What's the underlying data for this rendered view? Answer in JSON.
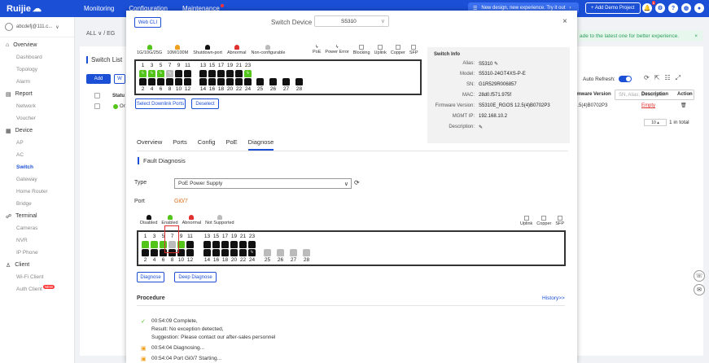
{
  "brand": {
    "logo": "Ruijie",
    "sub": "Cloud"
  },
  "topnav": {
    "items": [
      "Monitoring",
      "Configuration",
      "Maintenance"
    ],
    "new_design": "New design, new experience. Try it out",
    "demo": "+ Add Demo Project",
    "notif_count": "1"
  },
  "account": {
    "name": "abcdefj@111.c..."
  },
  "sidebar": {
    "overview": "Overview",
    "dashboard": "Dashboard",
    "topology": "Topology",
    "alarm": "Alarm",
    "report": "Report",
    "network": "Network",
    "voucher": "Voucher",
    "device": "Device",
    "ap": "AP",
    "ac": "AC",
    "switch": "Switch",
    "gateway": "Gateway",
    "home_router": "Home Router",
    "bridge": "Bridge",
    "terminal": "Terminal",
    "cameras": "Cameras",
    "nvr": "NVR",
    "ipphone": "IP Phone",
    "client": "Client",
    "wifi_client": "Wi-Fi Client",
    "auth_client": "Auth Client",
    "new_tag": "NEW"
  },
  "bg": {
    "all": "ALL ∨ / EG",
    "banner": "ade to the latest one for better experience.",
    "banner_close": "×",
    "switch_list": "Switch List",
    "add": "Add",
    "btn2": "W",
    "status_header": "Statu",
    "online": "Or",
    "auto_refresh": "Auto Refresh:",
    "search_placeholder": "SN, Alias, Description",
    "col_fw": "rmware Version",
    "col_desc": "Description",
    "col_action": "Action",
    "row_fw": "2.5(4)B0702P3",
    "row_desc": "Empty",
    "page_size": "10",
    "total": "1 in total"
  },
  "modal": {
    "web_cli": "Web CLI",
    "switch_device_label": "Switch Device",
    "switch_device_value": "S5310",
    "close": "×",
    "legend": [
      "1G/10G/25G",
      "10M/100M",
      "Shutdown-port",
      "Abnormal",
      "Non-configurable"
    ],
    "legend_colors": {
      "green": "#52c41a",
      "orange": "#f0a020",
      "black": "#111111",
      "red": "#e03030",
      "gray": "#bbbbbb"
    },
    "legend_right": [
      "PoE",
      "Power Error",
      "Blocking",
      "Uplink",
      "Copper",
      "SFP"
    ],
    "top_ports_odd": [
      "1",
      "3",
      "5",
      "7",
      "9",
      "11",
      "13",
      "15",
      "17",
      "19",
      "21",
      "23"
    ],
    "top_ports_even": [
      "2",
      "4",
      "6",
      "8",
      "10",
      "12",
      "14",
      "16",
      "18",
      "20",
      "22",
      "24"
    ],
    "top_sfp": [
      "25",
      "26",
      "27",
      "28"
    ],
    "select_downlink": "Select Downlink Ports",
    "deselect": "Deselect",
    "info": {
      "title": "Switch Info",
      "alias_k": "Alias:",
      "alias_v": "S5310",
      "model_k": "Model:",
      "model_v": "S5310-24GT4XS-P-E",
      "sn_k": "SN:",
      "sn_v": "G1R529R006857",
      "mac_k": "MAC:",
      "mac_v": "28d0.f571.975f",
      "fw_k": "Firmware Version:",
      "fw_v": "S5310E_RGOS 12.5(4)B0702P3",
      "ip_k": "MGMT IP:",
      "ip_v": "192.168.10.2",
      "desc_k": "Description:"
    },
    "tabs": [
      "Overview",
      "Ports",
      "Config",
      "PoE",
      "Diagnose"
    ],
    "fault_title": "Fault Diagnosis",
    "type_label": "Type",
    "type_value": "PoE Power Supply",
    "port_label": "Port",
    "port_value": "Gi0/7",
    "diag_legend": [
      "Disabled",
      "Enabled",
      "Abnormal",
      "Not Supported"
    ],
    "diag_legend_right": [
      "Uplink",
      "Copper",
      "SFP"
    ],
    "diag_odd": [
      "1",
      "3",
      "5",
      "7",
      "9",
      "11",
      "13",
      "15",
      "17",
      "19",
      "21",
      "23"
    ],
    "diag_even": [
      "2",
      "4",
      "6",
      "8",
      "10",
      "12",
      "14",
      "16",
      "18",
      "20",
      "22",
      "24"
    ],
    "diag_sfp": [
      "25",
      "26",
      "27",
      "28"
    ],
    "diagnose_btn": "Diagnose",
    "deep_btn": "Deep Diagnose",
    "procedure": "Procedure",
    "history": "History>>",
    "log": [
      "00:54:09 Complete,",
      "Result: No exception detected,",
      "Suggestion: Please contact our after-sales personnel",
      "00:54:04 Diagnosing...",
      "00:54:04 Port Gi0/7 Starting..."
    ]
  }
}
